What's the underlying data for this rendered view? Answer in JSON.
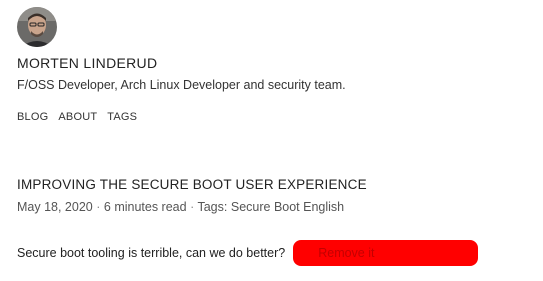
{
  "header": {
    "site_name": "MORTEN LINDERUD",
    "description": "F/OSS Developer, Arch Linux Developer and security team.",
    "avatar_icon": "person-portrait-icon"
  },
  "nav": {
    "items": [
      {
        "label": "BLOG"
      },
      {
        "label": "ABOUT"
      },
      {
        "label": "TAGS"
      }
    ]
  },
  "post": {
    "title": "IMPROVING THE SECURE BOOT USER EXPERIENCE",
    "date": "May 18, 2020",
    "separator": "·",
    "read_time": "6 minutes read",
    "tags_label": "Tags:",
    "tags": [
      "Secure Boot",
      "English"
    ],
    "summary": "Secure boot tooling is terrible, can we do better?"
  },
  "remove_button": {
    "label": "Remove it",
    "background": "#ff0000",
    "text_color": "#c40000"
  }
}
